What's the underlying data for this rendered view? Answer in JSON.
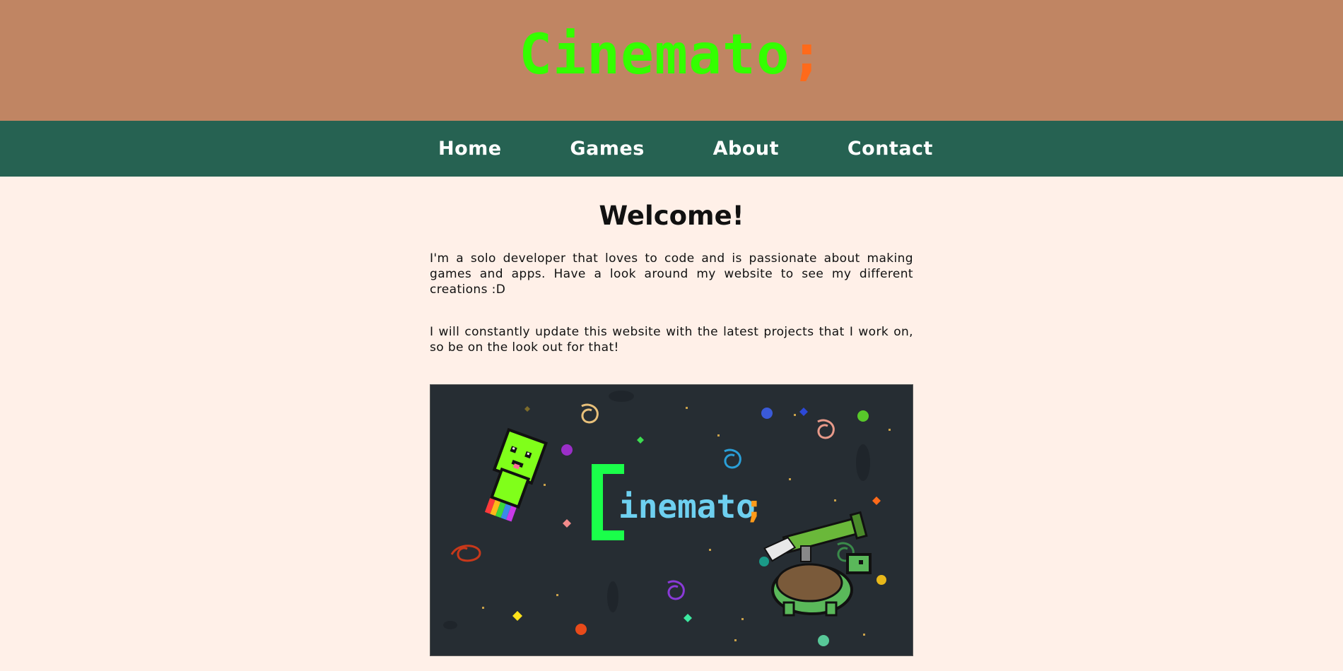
{
  "header": {
    "logo_text": "Cinemato",
    "logo_punct": ";"
  },
  "nav": {
    "items": [
      {
        "label": "Home"
      },
      {
        "label": "Games"
      },
      {
        "label": "About"
      },
      {
        "label": "Contact"
      }
    ]
  },
  "main": {
    "title": "Welcome!",
    "paragraphs": [
      "I'm a solo developer that loves to code and is passionate about making games and apps. Have a look around my website to see my different creations :D",
      "I will constantly update this website with the latest projects that I work on, so be on the look out for that!"
    ],
    "banner": {
      "logo_text": "inemato",
      "logo_initial": "C",
      "logo_punct": ";"
    }
  },
  "colors": {
    "header_bg": "#c08563",
    "nav_bg": "#266252",
    "page_bg": "#fff0e8",
    "logo_green": "#33ff00",
    "logo_orange": "#ff6a1a",
    "banner_bg": "#262d33",
    "banner_text": "#6ed0f0"
  }
}
